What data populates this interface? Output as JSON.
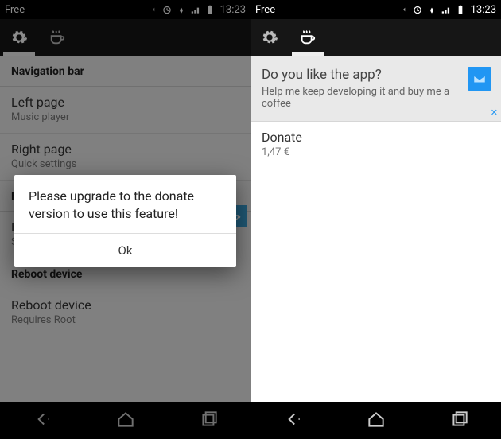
{
  "status": {
    "carrier": "Free",
    "time": "13:23"
  },
  "left_phone": {
    "sections": [
      {
        "header": "Navigation bar",
        "items": [
          {
            "title": "Left page",
            "sub": "Music player"
          },
          {
            "title": "Right page",
            "sub": "Quick settings"
          }
        ]
      },
      {
        "header": "F",
        "items": [
          {
            "title": "F",
            "sub": "S"
          }
        ]
      },
      {
        "header": "Reboot device",
        "items": [
          {
            "title": "Reboot device",
            "sub": "Requires Root"
          }
        ]
      }
    ],
    "dialog": {
      "message": "Please upgrade to the donate version to use this feature!",
      "ok": "Ok"
    }
  },
  "right_phone": {
    "card": {
      "title": "Do you like the app?",
      "sub": "Help me keep developing it and buy me a coffee"
    },
    "donate": {
      "title": "Donate",
      "sub": "1,47 €"
    }
  }
}
